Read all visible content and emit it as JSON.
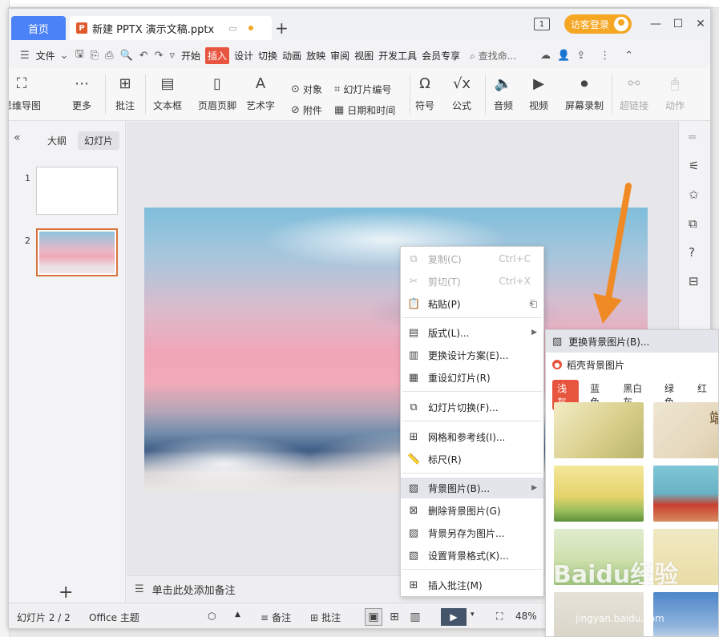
{
  "titlebar": {
    "home_tab": "首页",
    "doc_tab": "新建 PPTX 演示文稿.pptx",
    "doc_icon": "P",
    "new_tab": "+",
    "num_badge": "1",
    "login": "访客登录",
    "min": "—",
    "max": "☐",
    "close": "✕"
  },
  "menubar": {
    "file": "文件",
    "tabs": [
      "开始",
      "插入",
      "设计",
      "切换",
      "动画",
      "放映",
      "审阅",
      "视图",
      "开发工具",
      "会员专享"
    ],
    "active_tab": "插入",
    "search": "查找命..."
  },
  "ribbon": {
    "mindmap": "思维导图",
    "more": "更多",
    "comment": "批注",
    "textbox": "文本框",
    "header_footer": "页眉页脚",
    "wordart": "艺术字",
    "object": "对象",
    "attachment": "附件",
    "slide_number": "幻灯片编号",
    "datetime": "日期和时间",
    "symbol": "符号",
    "formula": "公式",
    "audio": "音频",
    "video": "视频",
    "screen_record": "屏幕录制",
    "hyperlink": "超链接",
    "action": "动作"
  },
  "leftpanel": {
    "outline": "大纲",
    "slides": "幻灯片",
    "thumb1": "1",
    "thumb2": "2",
    "add": "+"
  },
  "notes": "单击此处添加备注",
  "statusbar": {
    "slide_info": "幻灯片 2 / 2",
    "theme": "Office 主题",
    "notes": "备注",
    "comment": "批注",
    "zoom": "48%"
  },
  "context_menu": {
    "items": [
      {
        "label": "复制(C)",
        "shortcut": "Ctrl+C",
        "icon": "copy-icon"
      },
      {
        "label": "剪切(T)",
        "shortcut": "Ctrl+X",
        "icon": "cut-icon"
      },
      {
        "label": "粘贴(P)",
        "shortcut": "",
        "icon": "paste-icon"
      },
      {
        "label": "版式(L)...",
        "shortcut": "",
        "icon": "layout-icon"
      },
      {
        "label": "更换设计方案(E)...",
        "shortcut": "",
        "icon": "design-icon"
      },
      {
        "label": "重设幻灯片(R)",
        "shortcut": "",
        "icon": "reset-icon"
      },
      {
        "label": "幻灯片切换(F)...",
        "shortcut": "",
        "icon": "transition-icon"
      },
      {
        "label": "网格和参考线(I)...",
        "shortcut": "",
        "icon": "grid-icon"
      },
      {
        "label": "标尺(R)",
        "shortcut": "",
        "icon": "ruler-icon"
      },
      {
        "label": "背景图片(B)...",
        "shortcut": "",
        "icon": "bg-image-icon"
      },
      {
        "label": "删除背景图片(G)",
        "shortcut": "",
        "icon": "delete-bg-icon"
      },
      {
        "label": "背景另存为图片...",
        "shortcut": "",
        "icon": "save-bg-icon"
      },
      {
        "label": "设置背景格式(K)...",
        "shortcut": "",
        "icon": "format-bg-icon"
      },
      {
        "label": "插入批注(M)",
        "shortcut": "",
        "icon": "comment-icon"
      }
    ]
  },
  "submenu": {
    "replace_bg": "更换背景图片(B)...",
    "daoke_bg": "稻壳背景图片",
    "categories": [
      "浅灰",
      "蓝色",
      "黑白灰",
      "绿色",
      "红"
    ],
    "active_category": "浅灰",
    "thumb_caption": "端午"
  },
  "watermark": "Baidu经验",
  "watermark_url": "jingyan.baidu.com",
  "colors": {
    "accent": "#e8553f",
    "home_tab": "#4c82f7",
    "login": "#f5a623",
    "arrow": "#f08a24"
  }
}
